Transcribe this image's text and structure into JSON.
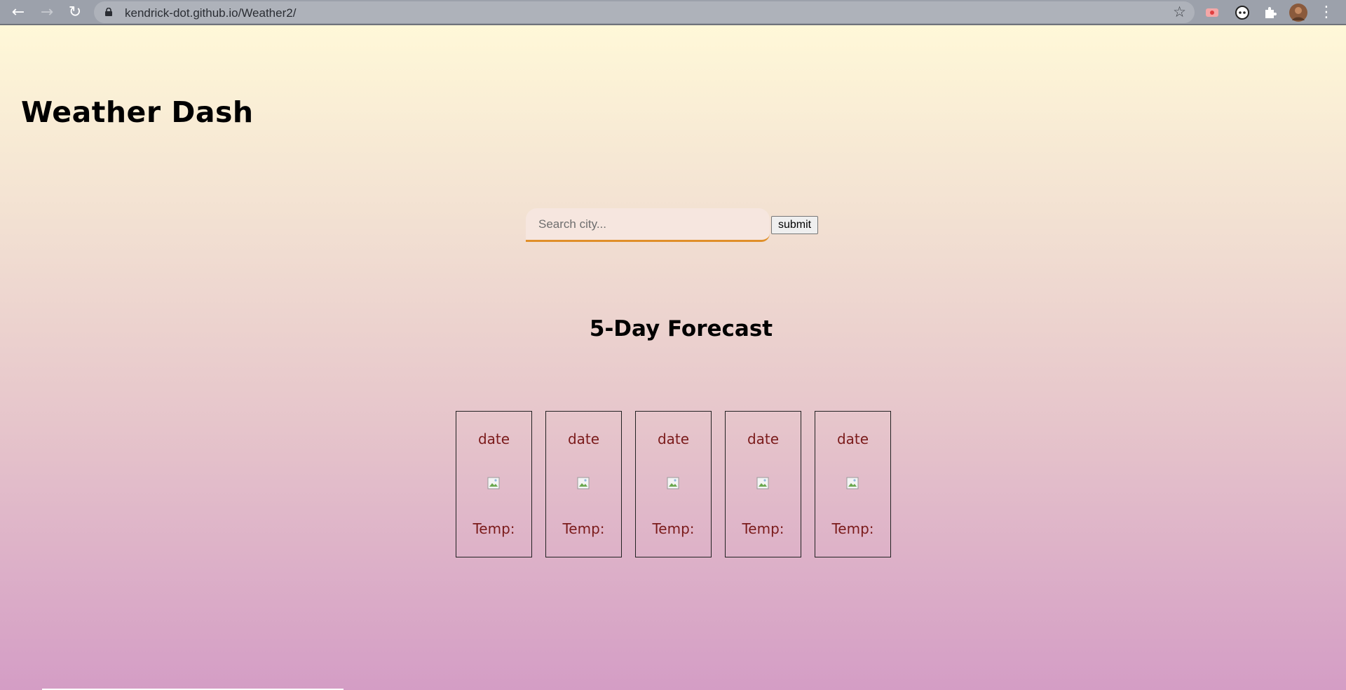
{
  "browser": {
    "url": "kendrick-dot.github.io/Weather2/",
    "back_icon": "←",
    "forward_icon": "→",
    "reload_icon": "↻",
    "star_icon": "☆",
    "menu_icon": "⋮"
  },
  "header": {
    "title": "Weather Dash"
  },
  "search": {
    "placeholder": "Search city...",
    "value": "",
    "submit_label": "submit"
  },
  "forecast": {
    "heading": "5-Day Forecast",
    "days": [
      {
        "date": "date",
        "temp": "Temp:"
      },
      {
        "date": "date",
        "temp": "Temp:"
      },
      {
        "date": "date",
        "temp": "Temp:"
      },
      {
        "date": "date",
        "temp": "Temp:"
      },
      {
        "date": "date",
        "temp": "Temp:"
      }
    ]
  },
  "colors": {
    "gradient_top": "#fff8d8",
    "gradient_bottom": "#d49dc5",
    "accent": "#e0902a",
    "card_text": "#7a1a1a"
  }
}
